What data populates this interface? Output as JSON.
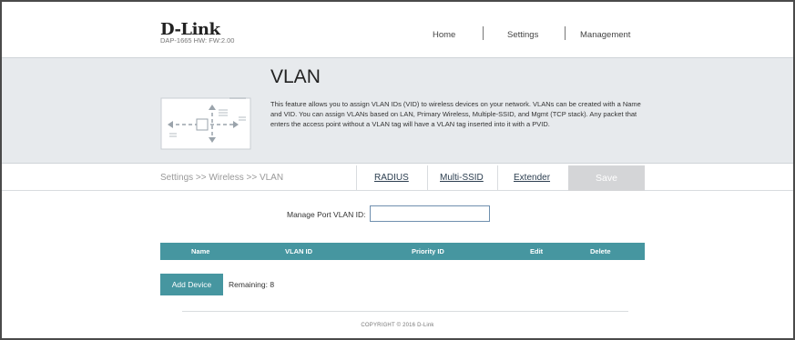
{
  "header": {
    "logo_text": "D-Link",
    "model_info": "DAP-1665 HW: FW:2.00",
    "nav": [
      "Home",
      "Settings",
      "Management"
    ]
  },
  "banner": {
    "title": "VLAN",
    "description": "This feature allows you to assign VLAN IDs (VID) to wireless devices on your network. VLANs can be created with a Name and VID. You can assign VLANs based on LAN, Primary Wireless, Multiple-SSID, and Mgmt (TCP stack). Any packet that enters the access point without a VLAN tag will have a VLAN tag inserted into it with a PVID.",
    "illustration_icon": "vlan-network-diagram-icon"
  },
  "subnav": {
    "breadcrumb": "Settings >> Wireless >> VLAN",
    "tabs": [
      "RADIUS",
      "Multi-SSID",
      "Extender"
    ],
    "save_label": "Save"
  },
  "form": {
    "port_vlan_label": "Manage Port VLAN ID:",
    "port_vlan_value": ""
  },
  "table": {
    "columns": [
      "Name",
      "VLAN ID",
      "Priority ID",
      "Edit",
      "Delete"
    ]
  },
  "actions": {
    "add_device_label": "Add Device",
    "remaining_text": "Remaining: 8"
  },
  "footer": {
    "copyright": "COPYRIGHT © 2016 D-Link"
  },
  "colors": {
    "accent": "#4696a0",
    "banner_bg": "#e7eaed",
    "save_disabled": "#d4d5d7"
  }
}
